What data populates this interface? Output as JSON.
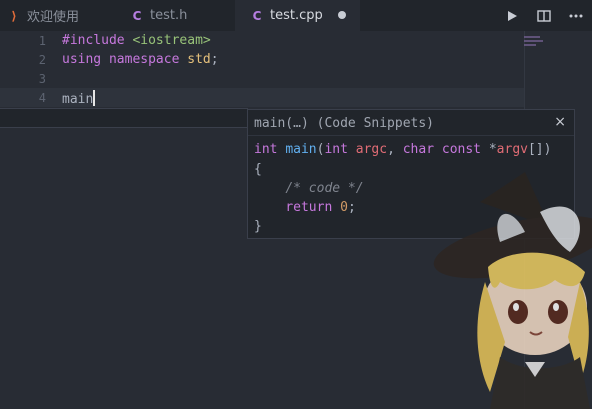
{
  "tabs": [
    {
      "icon": "vscode-icon",
      "label": "欢迎使用"
    },
    {
      "icon": "cpp-icon",
      "label": "test.h"
    },
    {
      "icon": "cpp-icon",
      "label": "test.cpp"
    }
  ],
  "toolbar": {
    "run": "run-icon",
    "split": "split-editor-icon",
    "more": "more-icon"
  },
  "editor": {
    "line_numbers": [
      "1",
      "2",
      "3",
      "4"
    ],
    "lines": {
      "l1_directive": "#include",
      "l1_header": "<iostream>",
      "l2_using": "using",
      "l2_namespace": "namespace",
      "l2_std": "std",
      "l2_semi": ";",
      "l4_text": "main"
    }
  },
  "snippet": {
    "title": "main(…) (Code Snippets)",
    "close": "×",
    "kw_int": "int",
    "fn_main": "main",
    "paren_open": "(",
    "kw_int2": "int",
    "argc": "argc",
    "comma": ",",
    "kw_char": "char",
    "kw_const": "const",
    "star": "*",
    "argv": "argv",
    "brackets_close": "[])",
    "open_brace": "{",
    "comment": "/* code */",
    "kw_return": "return",
    "zero": "0",
    "semi": ";",
    "close_brace": "}"
  }
}
